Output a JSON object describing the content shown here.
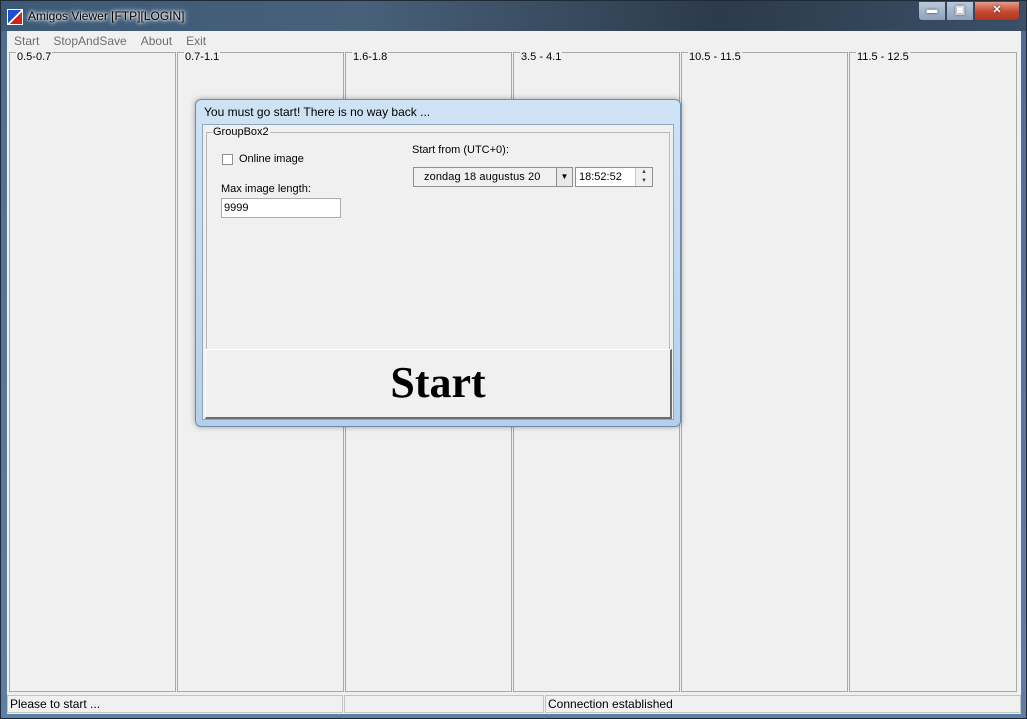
{
  "window": {
    "title": "Amigos Viewer [FTP][LOGIN]",
    "minimize": "▬",
    "maximize": "▣",
    "close": "✕"
  },
  "menu": [
    "Start",
    "StopAndSave",
    "About",
    "Exit"
  ],
  "columns": [
    "0.5-0.7",
    "0.7-1.1",
    "1.6-1.8",
    "3.5 - 4.1",
    "10.5 - 11.5",
    "11.5 - 12.5"
  ],
  "status": {
    "left": "Please to start ...",
    "middle": "",
    "right": "Connection established"
  },
  "dialog": {
    "title": "You must go start!  There is no way back ...",
    "group_title": "GroupBox2",
    "online_image_label": "Online image",
    "online_image_checked": false,
    "max_length_label": "Max image length:",
    "max_length_value": "9999",
    "start_from_label": "Start from (UTC+0):",
    "date_value": "zondag   18  augustus  20",
    "time_value": "18:52:52",
    "start_button": "Start"
  },
  "colors": {
    "accent": "#4c6f93",
    "dialog_frame": "#cfe3f5",
    "panel": "#f0f0f0"
  }
}
